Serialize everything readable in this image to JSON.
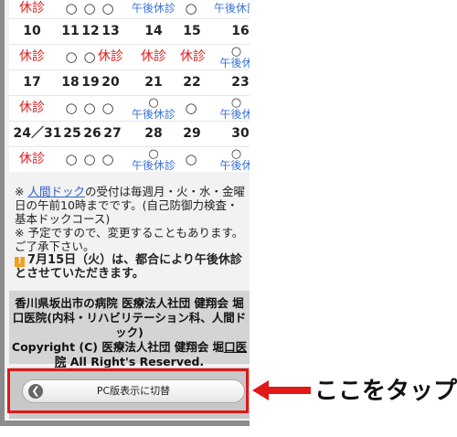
{
  "calendar": {
    "row1": {
      "a": "休診",
      "b": "○",
      "c": "○",
      "d": "○",
      "e": "午後休診",
      "f": "○",
      "g": "午後休診"
    },
    "row2": {
      "a": "10",
      "b": "11",
      "c": "12",
      "d": "13",
      "e": "14",
      "f": "15",
      "g": "16"
    },
    "row3": {
      "a": "休診",
      "b": "○",
      "c": "○",
      "d": "休診",
      "e": "休診",
      "f": "休診",
      "g_o": "○",
      "g_t": "午後休"
    },
    "row4": {
      "a": "17",
      "b": "18",
      "c": "19",
      "d": "20",
      "e": "21",
      "f": "22",
      "g": "23"
    },
    "row5": {
      "a": "休診",
      "b": "○",
      "c": "○",
      "d": "○",
      "e_o": "○",
      "e_t": "午後休診",
      "f": "○",
      "g_o": "○",
      "g_t": "午後休"
    },
    "row6": {
      "a": "24／31",
      "b": "25",
      "c": "26",
      "d": "27",
      "e": "28",
      "f": "29",
      "g": "30"
    },
    "row7": {
      "a": "休診",
      "b": "○",
      "c": "○",
      "d": "○",
      "e_o": "○",
      "e_t": "午後休診",
      "f": "○",
      "g_o": "○",
      "g_t": "午後休"
    }
  },
  "notes": {
    "n1_prefix": "※ ",
    "n1_link": "人間ドック",
    "n1_rest": "の受付は毎週月・火・水・金曜日の午前10時までです。(自己防御力検査・基本ドックコース)",
    "n2": "※ 予定ですので、変更することもあります。ご了承下さい。",
    "badge": "!",
    "n3": "7月15日（火）は、都合により午後休診とさせていただきます。"
  },
  "footer": {
    "line1": "香川県坂出市の病院 医療法人社団 健翔会 堀口医院(内科・リハビリテーション科、人間ドック)",
    "copyright": "Copyright (C) 医療法人社団 健翔会 堀",
    "link": "口医院",
    "rights": " All Right's Reserved."
  },
  "pc_button": {
    "label": "PC版表示に切替",
    "icon": "chevron-left-icon"
  },
  "callout": {
    "text": "ここをタップ"
  },
  "colors": {
    "red": "#e21a1a",
    "blue": "#3a73d4",
    "highlight": "#e01818"
  }
}
